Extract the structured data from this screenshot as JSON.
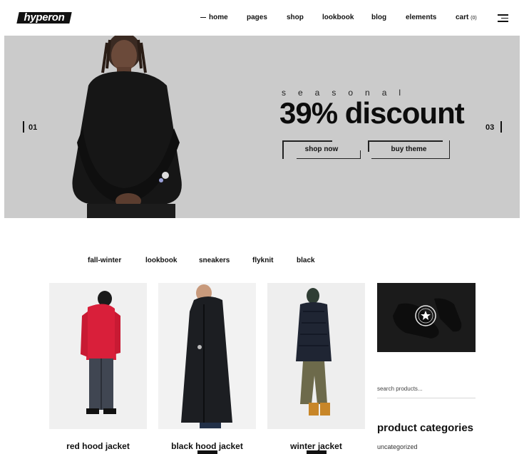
{
  "header": {
    "logo": "hyperon",
    "nav": {
      "home": "home",
      "pages": "pages",
      "shop": "shop",
      "lookbook": "lookbook",
      "blog": "blog",
      "elements": "elements",
      "cart": "cart",
      "cart_count": "(0)"
    },
    "menu_icon": "hamburger-menu-icon"
  },
  "hero": {
    "eyebrow": "seasonal",
    "headline": "39% discount",
    "slide_prev": "01",
    "slide_next": "03",
    "shop_now": "shop now",
    "buy_theme": "buy theme",
    "background": "#cbcbcb"
  },
  "filters": [
    "fall-winter",
    "lookbook",
    "sneakers",
    "flyknit",
    "black"
  ],
  "products": [
    {
      "name": "red hood jacket"
    },
    {
      "name": "black hood jacket"
    },
    {
      "name": "winter jacket"
    }
  ],
  "sidebar": {
    "search_placeholder": "search products...",
    "categories_title": "product categories",
    "categories": [
      "uncategorized"
    ]
  }
}
